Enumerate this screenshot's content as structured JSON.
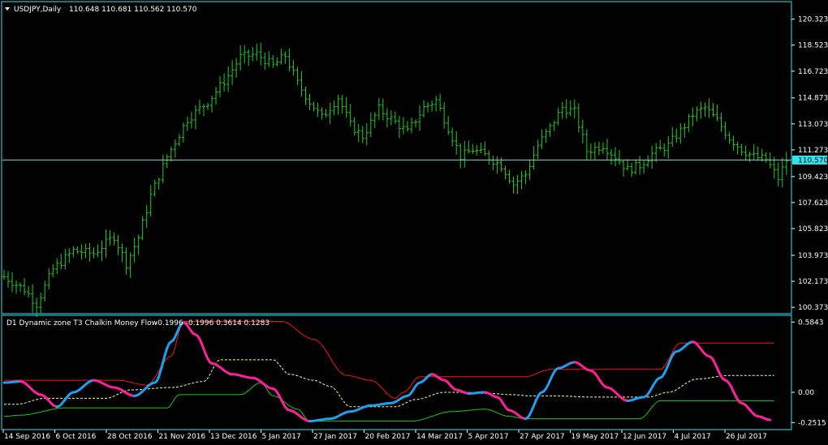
{
  "colors": {
    "background": "#000000",
    "frame": "#33e4ef",
    "bars": "#22cc22",
    "bid_line": "#7fd6dc",
    "price_box": "#33e4ef",
    "text": "#ffffff",
    "ind_up": "#1f9ff0",
    "ind_down": "#ff1f9a",
    "ind_upper": "#ff1010",
    "ind_lower": "#11cc11",
    "ind_mid": "#fffd9a"
  },
  "main": {
    "header": {
      "symbol": "USDJPY,Daily",
      "ohlc": "110.648 110.681 110.562 110.570"
    },
    "price_labels": [
      "120.323",
      "118.523",
      "116.723",
      "114.873",
      "113.073",
      "111.273",
      "109.423",
      "107.623",
      "105.823",
      "103.973",
      "102.173",
      "100.373"
    ],
    "current_price": "110.570",
    "last_close": 110.57,
    "y_range": [
      100.1,
      121.2
    ]
  },
  "indicator": {
    "header": {
      "name": "D1 Dynamic zone T3 Chalkin Money Flow",
      "values": "-0.1996 -0.1996 0.3614 0.1283"
    },
    "level_labels": [
      "0.5843",
      "0.00",
      "-0.2515"
    ],
    "y_range": [
      -0.29,
      0.62
    ]
  },
  "x_axis": {
    "dates": [
      "14 Sep 2016",
      "6 Oct 2016",
      "28 Oct 2016",
      "21 Nov 2016",
      "13 Dec 2016",
      "5 Jan 2017",
      "27 Jan 2017",
      "20 Feb 2017",
      "14 Mar 2017",
      "5 Apr 2017",
      "27 Apr 2017",
      "19 May 2017",
      "12 Jun 2017",
      "4 Jul 2017",
      "26 Jul 2017"
    ]
  },
  "chart_data": [
    {
      "type": "ohlc",
      "series": [
        {
          "name": "USDJPY,Daily"
        }
      ],
      "keypoints": [
        [
          0,
          102.5
        ],
        [
          5,
          101.6
        ],
        [
          8,
          100.6
        ],
        [
          12,
          103.0
        ],
        [
          17,
          104.3
        ],
        [
          22,
          104.1
        ],
        [
          27,
          105.3
        ],
        [
          30,
          103.4
        ],
        [
          33,
          105.2
        ],
        [
          36,
          108.1
        ],
        [
          40,
          110.8
        ],
        [
          45,
          113.4
        ],
        [
          50,
          114.6
        ],
        [
          55,
          116.4
        ],
        [
          58,
          117.7
        ],
        [
          62,
          117.9
        ],
        [
          66,
          117.1
        ],
        [
          69,
          117.8
        ],
        [
          72,
          115.9
        ],
        [
          75,
          114.6
        ],
        [
          78,
          113.5
        ],
        [
          82,
          114.9
        ],
        [
          85,
          113.0
        ],
        [
          88,
          112.2
        ],
        [
          92,
          114.1
        ],
        [
          96,
          113.2
        ],
        [
          99,
          112.5
        ],
        [
          103,
          114.2
        ],
        [
          106,
          114.7
        ],
        [
          109,
          112.8
        ],
        [
          112,
          110.8
        ],
        [
          115,
          111.3
        ],
        [
          118,
          110.9
        ],
        [
          122,
          110.2
        ],
        [
          125,
          108.9
        ],
        [
          128,
          109.6
        ],
        [
          131,
          111.6
        ],
        [
          134,
          112.8
        ],
        [
          137,
          114.2
        ],
        [
          140,
          113.9
        ],
        [
          143,
          111.2
        ],
        [
          147,
          111.6
        ],
        [
          150,
          110.8
        ],
        [
          153,
          109.9
        ],
        [
          156,
          110.2
        ],
        [
          159,
          111.0
        ],
        [
          163,
          111.6
        ],
        [
          166,
          112.6
        ],
        [
          169,
          113.7
        ],
        [
          172,
          114.2
        ],
        [
          175,
          113.3
        ],
        [
          178,
          112.1
        ],
        [
          181,
          111.3
        ],
        [
          184,
          110.8
        ],
        [
          187,
          110.6
        ],
        [
          190,
          109.3
        ],
        [
          192,
          110.57
        ]
      ]
    },
    {
      "type": "line",
      "title": "D1 Dynamic zone T3 Chalkin Money Flow",
      "series": [
        {
          "points": [
            [
              0,
              0.08
            ],
            [
              4,
              0.09
            ],
            [
              9,
              -0.02
            ],
            [
              13,
              -0.12
            ],
            [
              17,
              0.0
            ],
            [
              22,
              0.1
            ],
            [
              27,
              0.04
            ],
            [
              32,
              -0.03
            ],
            [
              37,
              0.08
            ],
            [
              41,
              0.42
            ],
            [
              44,
              0.58
            ],
            [
              47,
              0.48
            ],
            [
              51,
              0.24
            ],
            [
              56,
              0.15
            ],
            [
              61,
              0.12
            ],
            [
              66,
              0.03
            ],
            [
              70,
              -0.15
            ],
            [
              75,
              -0.24
            ],
            [
              80,
              -0.22
            ],
            [
              85,
              -0.16
            ],
            [
              90,
              -0.11
            ],
            [
              95,
              -0.09
            ],
            [
              99,
              -0.03
            ],
            [
              102,
              0.08
            ],
            [
              105,
              0.15
            ],
            [
              108,
              0.1
            ],
            [
              111,
              0.02
            ],
            [
              114,
              -0.01
            ],
            [
              118,
              0.0
            ],
            [
              121,
              -0.04
            ],
            [
              124,
              -0.15
            ],
            [
              128,
              -0.22
            ],
            [
              132,
              0.0
            ],
            [
              136,
              0.2
            ],
            [
              140,
              0.25
            ],
            [
              144,
              0.18
            ],
            [
              148,
              0.04
            ],
            [
              153,
              -0.07
            ],
            [
              157,
              -0.04
            ],
            [
              161,
              0.12
            ],
            [
              165,
              0.34
            ],
            [
              169,
              0.42
            ],
            [
              173,
              0.3
            ],
            [
              177,
              0.1
            ],
            [
              181,
              -0.09
            ],
            [
              185,
              -0.2
            ],
            [
              188,
              -0.23
            ]
          ]
        },
        {
          "points": [
            [
              0,
              0.1
            ],
            [
              28,
              0.1
            ],
            [
              35,
              0.06
            ],
            [
              41,
              0.3
            ],
            [
              44,
              0.59
            ],
            [
              68,
              0.59
            ],
            [
              76,
              0.44
            ],
            [
              84,
              0.14
            ],
            [
              90,
              0.1
            ],
            [
              96,
              -0.05
            ],
            [
              98,
              0.0
            ],
            [
              102,
              0.13
            ],
            [
              128,
              0.13
            ],
            [
              134,
              0.19
            ],
            [
              161,
              0.19
            ],
            [
              166,
              0.41
            ],
            [
              189,
              0.41
            ]
          ]
        },
        {
          "points": [
            [
              0,
              -0.2
            ],
            [
              4,
              -0.19
            ],
            [
              15,
              -0.13
            ],
            [
              40,
              -0.13
            ],
            [
              43,
              -0.02
            ],
            [
              58,
              -0.02
            ],
            [
              63,
              0.08
            ],
            [
              66,
              -0.03
            ],
            [
              72,
              -0.14
            ],
            [
              75,
              -0.24
            ],
            [
              100,
              -0.24
            ],
            [
              110,
              -0.16
            ],
            [
              118,
              -0.14
            ],
            [
              124,
              -0.2
            ],
            [
              128,
              -0.22
            ],
            [
              147,
              -0.22
            ],
            [
              156,
              -0.22
            ],
            [
              161,
              -0.07
            ],
            [
              189,
              -0.07
            ]
          ]
        },
        {
          "points": [
            [
              0,
              -0.1
            ],
            [
              3,
              -0.1
            ],
            [
              10,
              -0.05
            ],
            [
              25,
              -0.05
            ],
            [
              31,
              0.02
            ],
            [
              41,
              0.04
            ],
            [
              49,
              0.09
            ],
            [
              53,
              0.27
            ],
            [
              66,
              0.27
            ],
            [
              70,
              0.15
            ],
            [
              76,
              0.1
            ],
            [
              80,
              0.05
            ],
            [
              85,
              -0.12
            ],
            [
              96,
              -0.12
            ],
            [
              101,
              -0.06
            ],
            [
              108,
              0.0
            ],
            [
              113,
              0.0
            ],
            [
              119,
              -0.01
            ],
            [
              125,
              -0.02
            ],
            [
              129,
              -0.03
            ],
            [
              136,
              -0.03
            ],
            [
              144,
              -0.04
            ],
            [
              152,
              -0.04
            ],
            [
              158,
              -0.04
            ],
            [
              163,
              0.0
            ],
            [
              170,
              0.11
            ],
            [
              178,
              0.14
            ],
            [
              189,
              0.14
            ]
          ]
        }
      ]
    }
  ]
}
